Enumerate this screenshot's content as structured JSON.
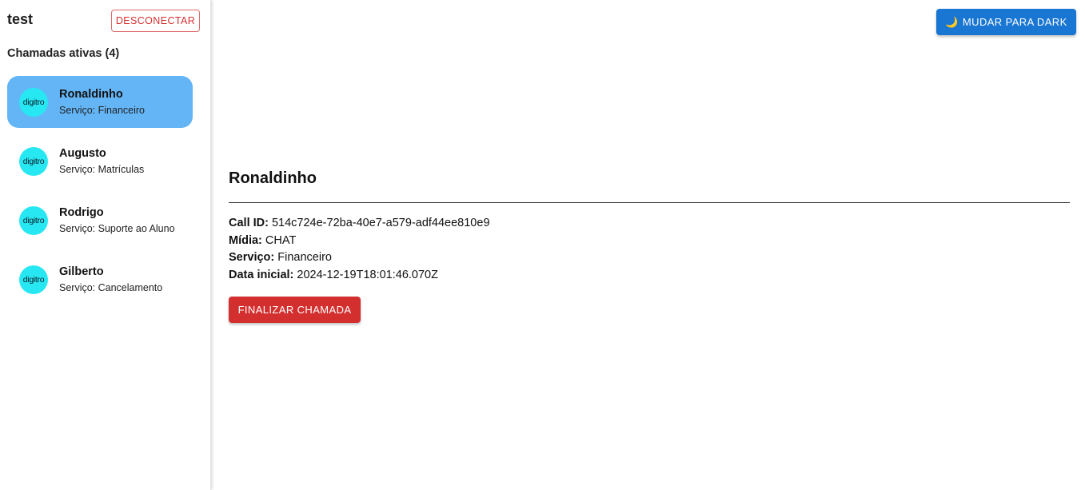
{
  "sidebar": {
    "user_name": "test",
    "disconnect_label": "DESCONECTAR",
    "calls_heading": "Chamadas ativas (4)",
    "calls": [
      {
        "name": "Ronaldinho",
        "service": "Serviço: Financeiro",
        "avatar_text": "digitro",
        "active": true
      },
      {
        "name": "Augusto",
        "service": "Serviço: Matrículas",
        "avatar_text": "digitro",
        "active": false
      },
      {
        "name": "Rodrigo",
        "service": "Serviço: Suporte ao Aluno",
        "avatar_text": "digitro",
        "active": false
      },
      {
        "name": "Gilberto",
        "service": "Serviço: Cancelamento",
        "avatar_text": "digitro",
        "active": false
      }
    ]
  },
  "header": {
    "theme_icon": "moon-icon",
    "theme_label": "MUDAR PARA DARK"
  },
  "detail": {
    "title": "Ronaldinho",
    "call_id_label": "Call ID:",
    "call_id": "514c724e-72ba-40e7-a579-adf44ee810e9",
    "media_label": "Mídia:",
    "media": "CHAT",
    "service_label": "Serviço:",
    "service": "Financeiro",
    "start_label": "Data inicial:",
    "start": "2024-12-19T18:01:46.070Z",
    "end_call_label": "FINALIZAR CHAMADA"
  },
  "colors": {
    "primary": "#1976d2",
    "danger": "#d32f2f",
    "active_item": "#64b5f6",
    "avatar": "#27e8f2"
  }
}
